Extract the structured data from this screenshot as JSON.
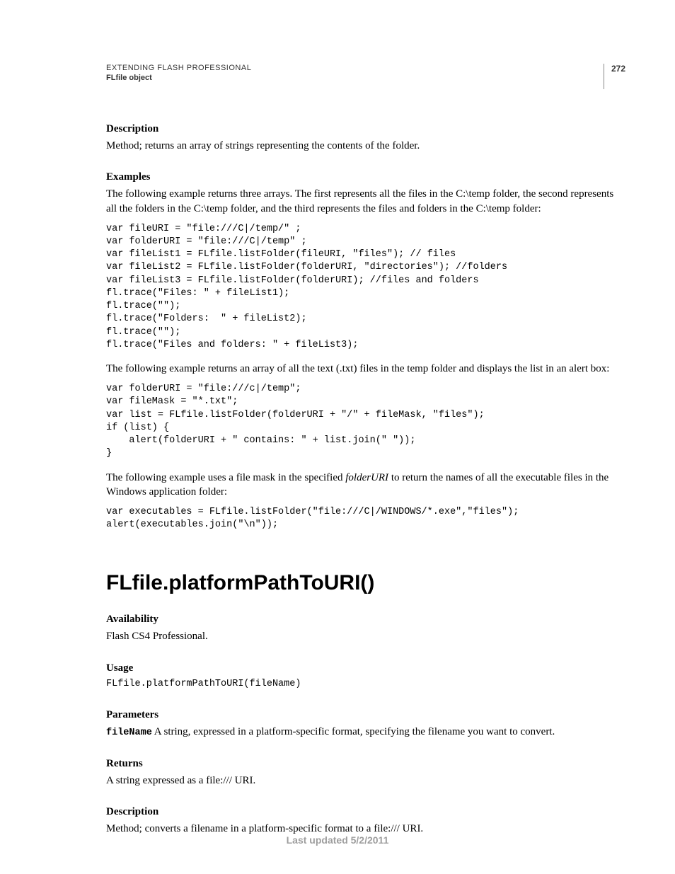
{
  "header": {
    "title": "EXTENDING FLASH PROFESSIONAL",
    "subtitle": "FLfile object",
    "page": "272"
  },
  "sec1": {
    "desc_h": "Description",
    "desc_p": "Method; returns an array of strings representing the contents of the folder.",
    "ex_h": "Examples",
    "ex_p1": "The following example returns three arrays. The first represents all the files in the C:\\temp folder, the second represents all the folders in the C:\\temp folder, and the third represents the files and folders in the C:\\temp folder:",
    "code1": "var fileURI = \"file:///C|/temp/\" ;\nvar folderURI = \"file:///C|/temp\" ;\nvar fileList1 = FLfile.listFolder(fileURI, \"files\"); // files\nvar fileList2 = FLfile.listFolder(folderURI, \"directories\"); //folders\nvar fileList3 = FLfile.listFolder(folderURI); //files and folders\nfl.trace(\"Files: \" + fileList1);\nfl.trace(\"\");\nfl.trace(\"Folders:  \" + fileList2);\nfl.trace(\"\");\nfl.trace(\"Files and folders: \" + fileList3);",
    "ex_p2": "The following example returns an array of all the text (.txt) files in the temp folder and displays the list in an alert box:",
    "code2": "var folderURI = \"file:///c|/temp\";\nvar fileMask = \"*.txt\";\nvar list = FLfile.listFolder(folderURI + \"/\" + fileMask, \"files\");\nif (list) {\n    alert(folderURI + \" contains: \" + list.join(\" \"));\n}",
    "ex_p3a": "The following example uses a file mask in the specified ",
    "ex_p3_it": "folderURI",
    "ex_p3b": " to return the names of all the executable files in the Windows application folder:",
    "code3": "var executables = FLfile.listFolder(\"file:///C|/WINDOWS/*.exe\",\"files\");\nalert(executables.join(\"\\n\"));"
  },
  "sec2": {
    "h1": "FLfile.platformPathToURI()",
    "avail_h": "Availability",
    "avail_p": "Flash CS4 Professional.",
    "usage_h": "Usage",
    "usage_code": "FLfile.platformPathToURI(fileName)",
    "params_h": "Parameters",
    "param_name": "fileName",
    "param_desc": "  A string, expressed in a platform-specific format, specifying the filename you want to convert.",
    "returns_h": "Returns",
    "returns_p": "A string expressed as a file:/// URI.",
    "desc_h": "Description",
    "desc_p": "Method; converts a filename in a platform-specific format to a file:/// URI."
  },
  "footer": "Last updated 5/2/2011"
}
